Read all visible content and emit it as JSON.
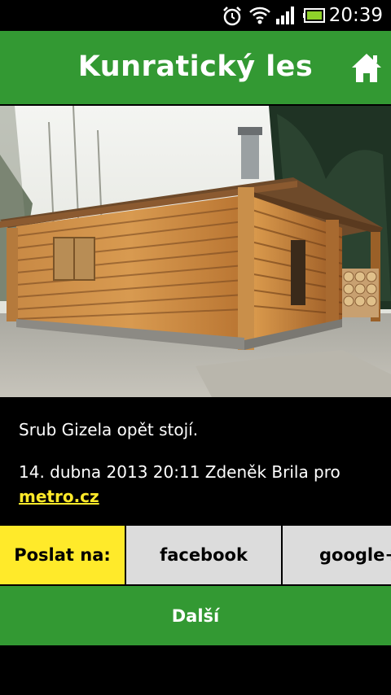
{
  "status_bar": {
    "time": "20:39",
    "icons": [
      "alarm-icon",
      "wifi-icon",
      "signal-icon",
      "battery-icon"
    ]
  },
  "header": {
    "title": "Kunratický les",
    "home_icon": "home-icon",
    "bg_color": "#339933"
  },
  "article": {
    "caption": "Srub Gizela opět stojí.",
    "meta": "14. dubna 2013 20:11 Zdeněk Brila pro",
    "source_link": "metro.cz"
  },
  "share": {
    "label": "Poslat na:",
    "targets": [
      "facebook",
      "google+"
    ]
  },
  "footer": {
    "next_label": "Další"
  },
  "colors": {
    "accent_green": "#339933",
    "highlight_yellow": "#ffea2a",
    "share_button_gray": "#dcdcdc"
  }
}
